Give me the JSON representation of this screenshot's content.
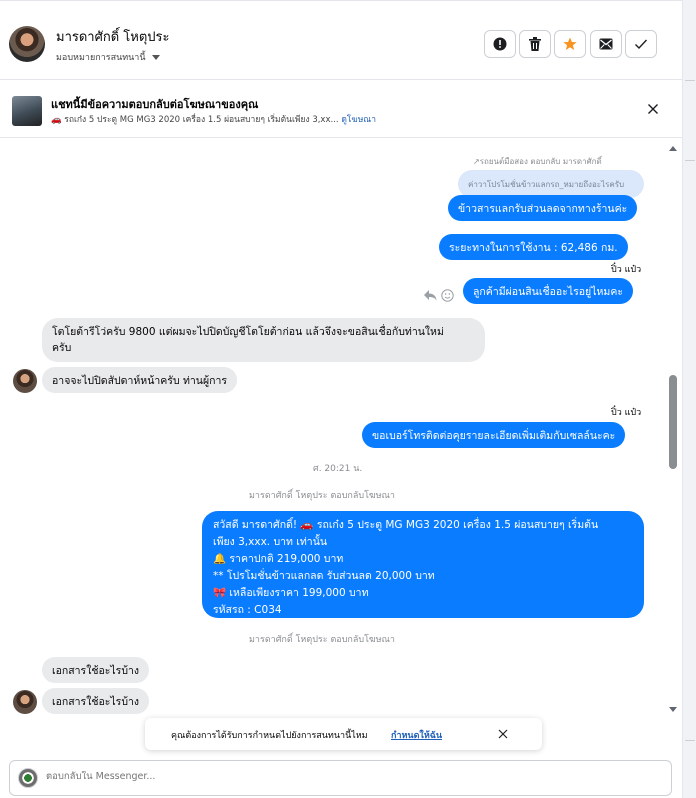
{
  "header": {
    "contact_name": "มารดาศักดิ์ โหตุประ",
    "assign_label": "มอบหมายการสนทนานี้",
    "buttons": [
      "spam-icon",
      "trash-icon",
      "star-icon",
      "mark-unread-icon",
      "check-icon"
    ]
  },
  "ad_banner": {
    "title": "แชทนี้มีข้อความตอบกลับต่อโฆษณาของคุณ",
    "subtitle": "🚗 รถเก๋ง 5 ประตู MG MG3 2020 เครื่อง 1.5 ผ่อนสบายๆ เริ่มต้นเพียง 3,xx...",
    "link": "ดูโฆษณา"
  },
  "messages": {
    "reply_meta": "↗รถยนต์มือสอง ตอบกลับ มารดาศักดิ์",
    "reply_preview": "ค่าวาโปรโมชั่นข้าวแลกรถ_หมายถึงอะไรครับ",
    "out_1": "ข้าวสารแลกรับส่วนลดจากทางร้านค่ะ",
    "out_2": "ระยะทางในการใช้งาน :      62,486 กม.",
    "sender_1": "ปิ๋ว แป๋ว",
    "out_3": "ลูกค้ามีผ่อนสินเชื่ออะไรอยู่ไหมคะ",
    "in_1_line1": "โตโยต้ารีโว่ครับ 9800 แต่ผมจะไปปิดบัญชีโตโยต้าก่อน แล้วจึงจะขอสินเชื่อกับท่านใหม่",
    "in_1_line2": "ครับ",
    "in_2": "อาจจะไปปิดสัปดาห์หน้าครับ ท่านผู้การ",
    "sender_2": "ปิ๋ว แป๋ว",
    "out_4": "ขอเบอร์โทรติดต่อคุยรายละเอียดเพิ่มเติมกับเซลล์นะคะ",
    "timestamp": "ศ. 20:21 น.",
    "ad_reply_meta_1": "มารดาศักดิ์ โหตุประ ตอบกลับโฆษณา",
    "big_lines": [
      "สวัสดี มารดาศักดิ์! 🚗 รถเก๋ง 5 ประตู MG MG3 2020 เครื่อง 1.5 ผ่อนสบายๆ เริ่มต้น",
      "เพียง 3,xxx. บาท เท่านั้น",
      "🔔 ราคาปกติ 219,000 บาท",
      "** โปรโมชั่นข้าวแลกลด รับส่วนลด 20,000 บาท",
      "🎀  เหลือเพียงราคา 199,000 บาท",
      " รหัสรถ : C034"
    ],
    "ad_reply_meta_2": "มารดาศักดิ์ โหตุประ ตอบกลับโฆษณา",
    "in_3": "เอกสารใช้อะไรบ้าง",
    "in_4": "เอกสารใช้อะไรบ้าง"
  },
  "toast": {
    "text": "คุณต้องการได้รับการกำหนดไปยังการสนทนานี้ไหม",
    "link": "กำหนดให้ฉัน"
  },
  "composer": {
    "placeholder": "ตอบกลับใน Messenger..."
  },
  "colors": {
    "outgoing_bubble": "#0a7cff",
    "incoming_bubble": "#e9eaec",
    "link": "#1f5fb9",
    "star": "#f7931e"
  }
}
